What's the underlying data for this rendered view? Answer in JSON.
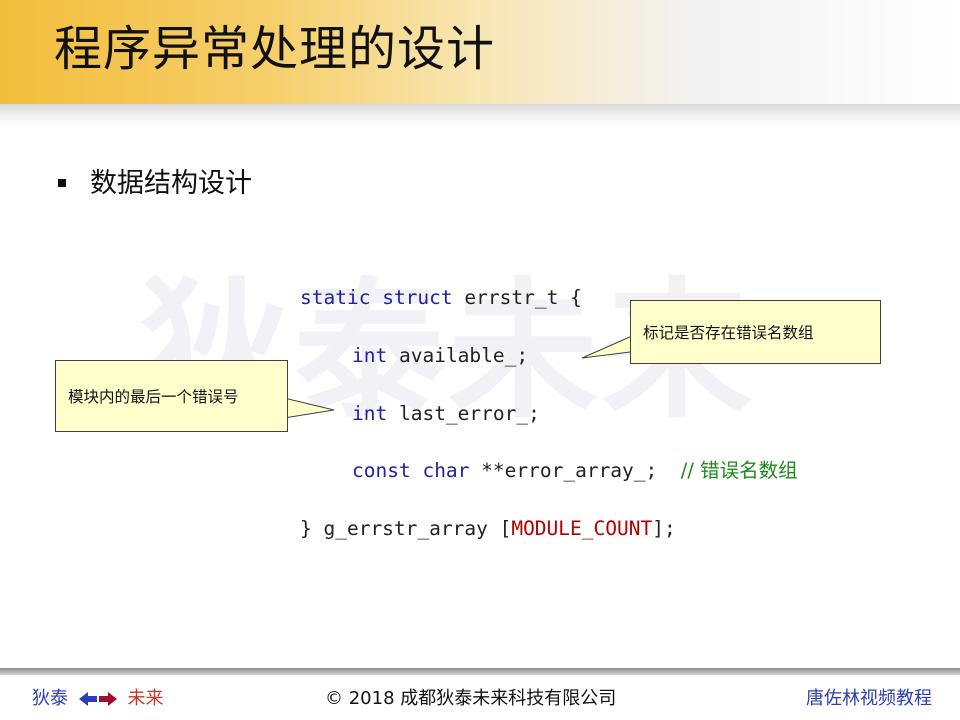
{
  "slide": {
    "title": "程序异常处理的设计",
    "watermark": "狄泰未来",
    "bullet": "数据结构设计"
  },
  "code": {
    "line1": {
      "kw1": "static",
      "kw2": "struct",
      "rest": "errstr_t {"
    },
    "line2": {
      "kw": "int",
      "rest": "available_;"
    },
    "line3": {
      "kw": "int",
      "rest": "last_error_;"
    },
    "line4": {
      "kw1": "const",
      "kw2": "char",
      "rest": "**error_array_;",
      "comment": "// 错误名数组"
    },
    "line5": {
      "start": "} g_errstr_array [",
      "macro": "MODULE_COUNT",
      "end": "];"
    }
  },
  "callouts": {
    "available": "标记是否存在错误名数组",
    "last_error": "模块内的最后一个错误号"
  },
  "footer": {
    "brand_left": "狄泰",
    "brand_right": "未来",
    "copyright": "© 2018 成都狄泰未来科技有限公司",
    "course": "唐佐林视频教程"
  },
  "colors": {
    "title_gradient_start": "#f2bd3c",
    "keyword": "#1f1fa8",
    "macro": "#b00000",
    "comment": "#1c8a1c",
    "callout_fill": "#ffffcc",
    "footer_blue": "#2b3db8",
    "footer_red": "#c0392b"
  },
  "icons": {
    "bullet": "square-bullet-icon",
    "arrows": "left-right-arrows-icon"
  }
}
